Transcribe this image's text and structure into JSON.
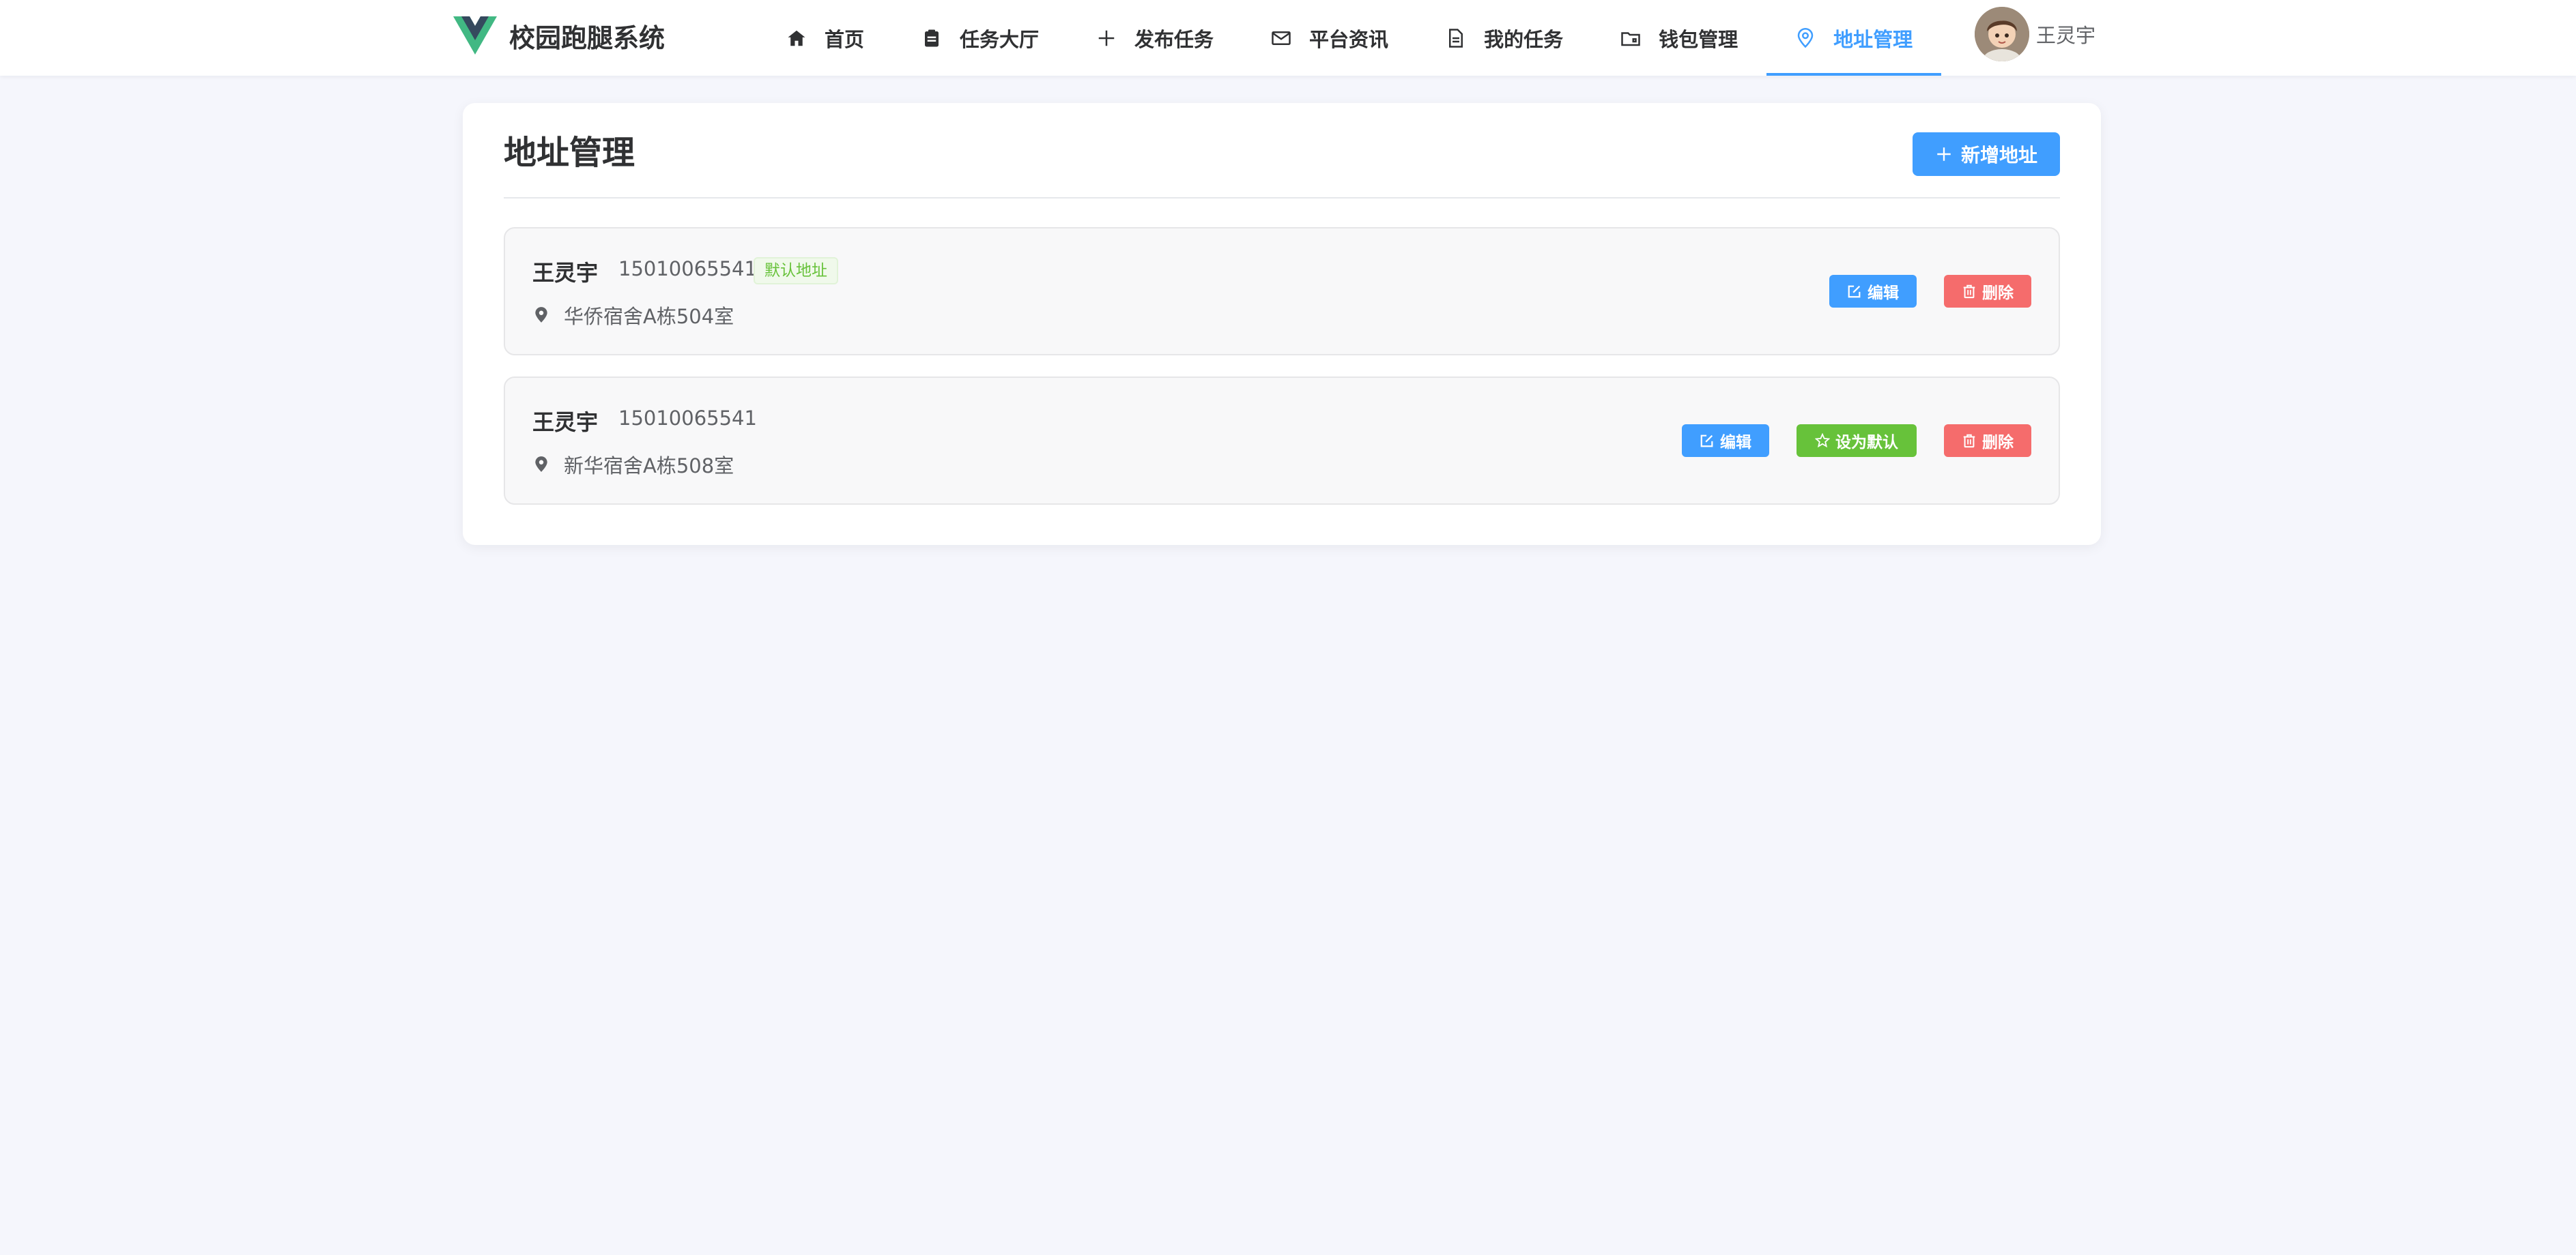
{
  "app": {
    "title": "校园跑腿系统"
  },
  "nav": {
    "items": [
      {
        "label": "首页",
        "icon": "home-icon"
      },
      {
        "label": "任务大厅",
        "icon": "clipboard-icon"
      },
      {
        "label": "发布任务",
        "icon": "plus-icon"
      },
      {
        "label": "平台资讯",
        "icon": "mail-icon"
      },
      {
        "label": "我的任务",
        "icon": "document-icon"
      },
      {
        "label": "钱包管理",
        "icon": "wallet-icon"
      },
      {
        "label": "地址管理",
        "icon": "location-icon",
        "active": true
      }
    ]
  },
  "user": {
    "name": "王灵宇"
  },
  "page": {
    "title": "地址管理",
    "add_label": "新增地址"
  },
  "addresses": [
    {
      "name": "王灵宇",
      "phone": "15010065541",
      "default_tag": "默认地址",
      "address": "华侨宿舍A栋504室",
      "edit_label": "编辑",
      "delete_label": "删除"
    },
    {
      "name": "王灵宇",
      "phone": "15010065541",
      "address": "新华宿舍A栋508室",
      "edit_label": "编辑",
      "set_default_label": "设为默认",
      "delete_label": "删除"
    }
  ],
  "colors": {
    "primary": "#409eff",
    "success": "#67c23a",
    "danger": "#f56c6c",
    "background": "#f5f6fc"
  }
}
